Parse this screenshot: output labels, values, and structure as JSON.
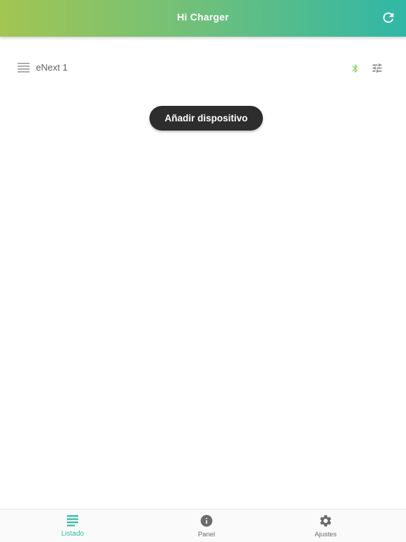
{
  "header": {
    "title": "Hi Charger",
    "refresh_icon": "refresh-icon"
  },
  "device": {
    "name": "eNext 1",
    "menu_icon": "menu-lines-icon",
    "bluetooth_icon": "bluetooth-icon",
    "settings_icon": "tune-sliders-icon",
    "bluetooth_color": "#7ed957"
  },
  "actions": {
    "add_device_label": "Añadir dispositivo"
  },
  "nav": {
    "items": [
      {
        "label": "Listado",
        "icon": "list-icon",
        "active": true
      },
      {
        "label": "Panel",
        "icon": "info-icon",
        "active": false
      },
      {
        "label": "Ajustes",
        "icon": "gear-icon",
        "active": false
      }
    ],
    "active_color": "#2fbfa5"
  },
  "colors": {
    "header_gradient_start": "#a3c552",
    "header_gradient_end": "#2fb7a6",
    "button_bg": "#2d2d2d"
  }
}
